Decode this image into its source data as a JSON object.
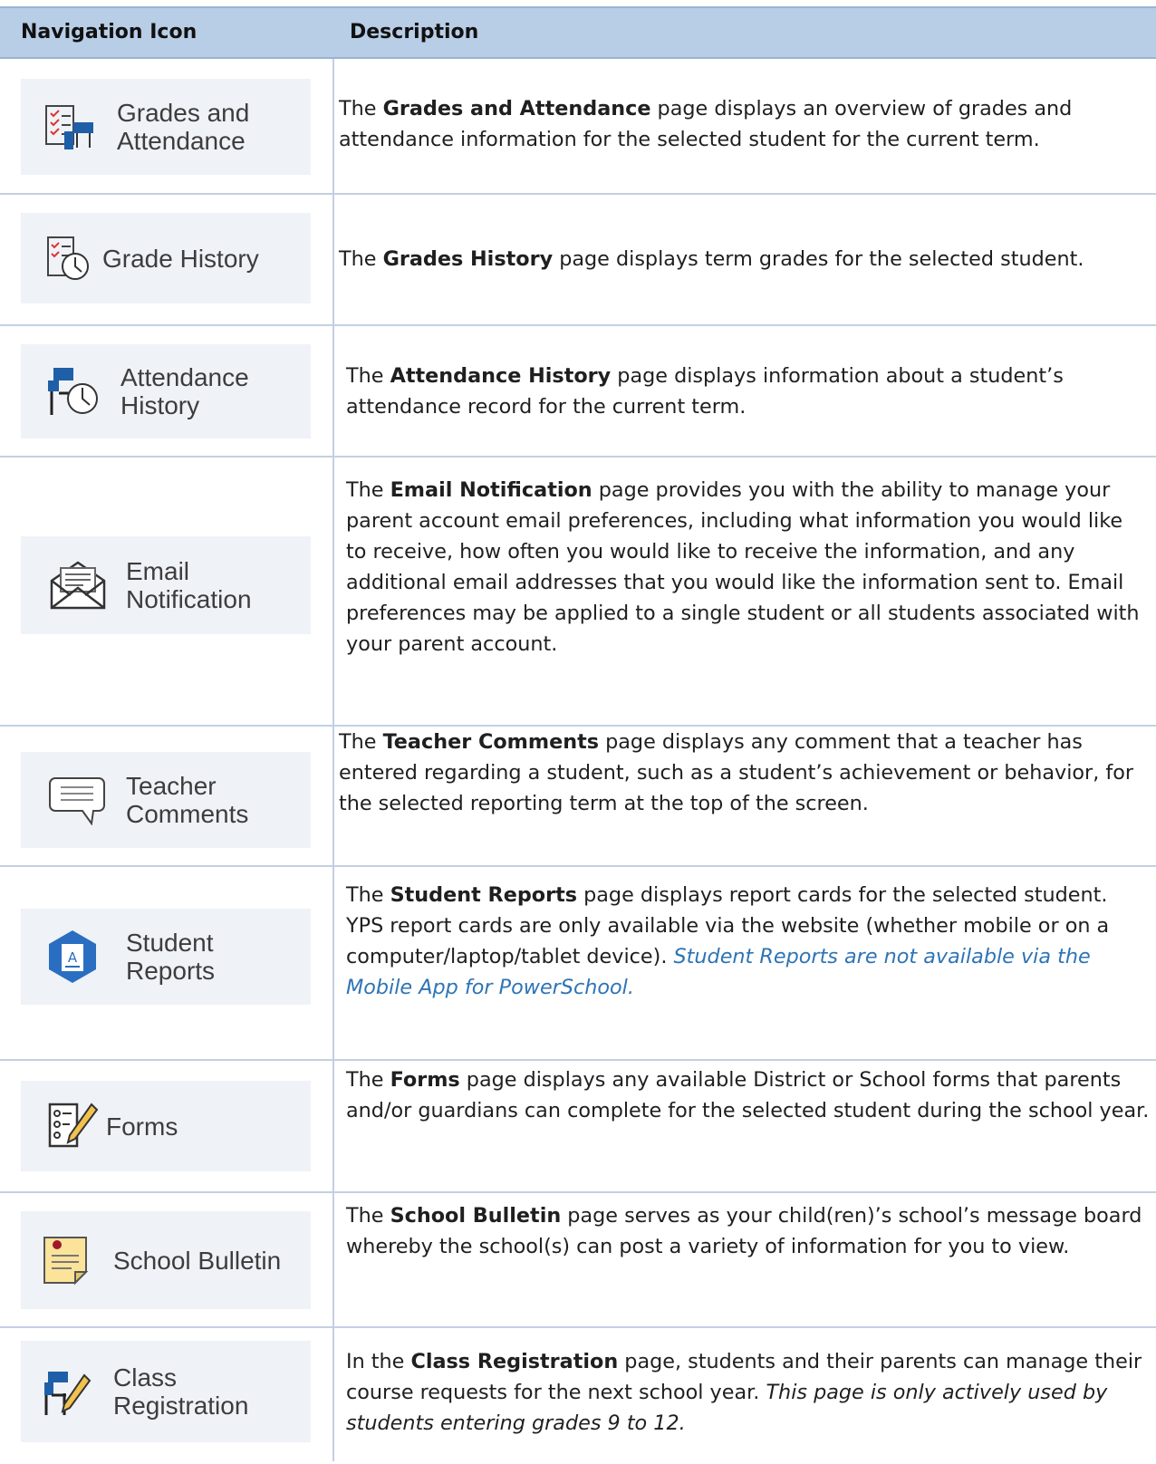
{
  "header": {
    "col1": "Navigation Icon",
    "col2": "Description"
  },
  "rows": [
    {
      "icon": "grades-attendance-icon",
      "label1": "Grades and",
      "label2": "Attendance",
      "pre": "The ",
      "bold": "Grades and Attendance",
      "post": " page displays an overview of grades and attendance information for the selected student for the current term."
    },
    {
      "icon": "grade-history-icon",
      "label1": "Grade History",
      "label2": "",
      "pre": "The ",
      "bold": "Grades History",
      "post": " page displays term grades for the selected student."
    },
    {
      "icon": "attendance-history-icon",
      "label1": "Attendance",
      "label2": "History",
      "pre": "The ",
      "bold": "Attendance History",
      "post": " page displays information about a student’s attendance record for the current term."
    },
    {
      "icon": "email-envelope-icon",
      "label1": "Email",
      "label2": "Notification",
      "pre": "The ",
      "bold": "Email Notification",
      "post": " page provides you with the ability to manage your parent account email preferences, including what information you would like to receive, how often you would like to receive the information, and any additional email addresses that you would like the information sent to. Email preferences may be applied to a single student or all students associated with your parent account."
    },
    {
      "icon": "speech-bubble-icon",
      "label1": "Teacher",
      "label2": "Comments",
      "pre": "The ",
      "bold": "Teacher Comments",
      "post": " page displays any comment that a teacher has entered regarding a student, such as a student’s achievement or behavior, for the selected reporting term at the top of the screen."
    },
    {
      "icon": "student-reports-hexagon-icon",
      "label1": "Student",
      "label2": "Reports",
      "pre": "The ",
      "bold": "Student Reports",
      "post": " page displays report cards for the selected student. YPS report cards are only available via the website (whether mobile or on a computer/laptop/tablet device). ",
      "note": "Student Reports are not available via the Mobile App for PowerSchool."
    },
    {
      "icon": "forms-checklist-pencil-icon",
      "label1": "Forms",
      "label2": "",
      "pre": "The ",
      "bold": "Forms",
      "post": " page displays any available District or School forms that parents and/or guardians can complete for the selected student during the school year."
    },
    {
      "icon": "bulletin-note-pin-icon",
      "label1": "School Bulletin",
      "label2": "",
      "pre": "The ",
      "bold": "School Bulletin",
      "post": " page serves as your child(ren)’s school’s message board whereby the school(s) can post a variety of information for you to view."
    },
    {
      "icon": "desk-pencil-icon",
      "label1": "Class",
      "label2": "Registration",
      "pre": "In the ",
      "bold": "Class Registration",
      "post": " page, students and their parents can manage their course requests for the next school year.  ",
      "italic": "This page is only actively used by students entering grades 9 to 12."
    }
  ],
  "colors": {
    "header_bg": "#b8cde6",
    "nav_bg": "#eff2f7",
    "icon_blue": "#1f5fa8",
    "note_blue": "#2e74b5"
  }
}
